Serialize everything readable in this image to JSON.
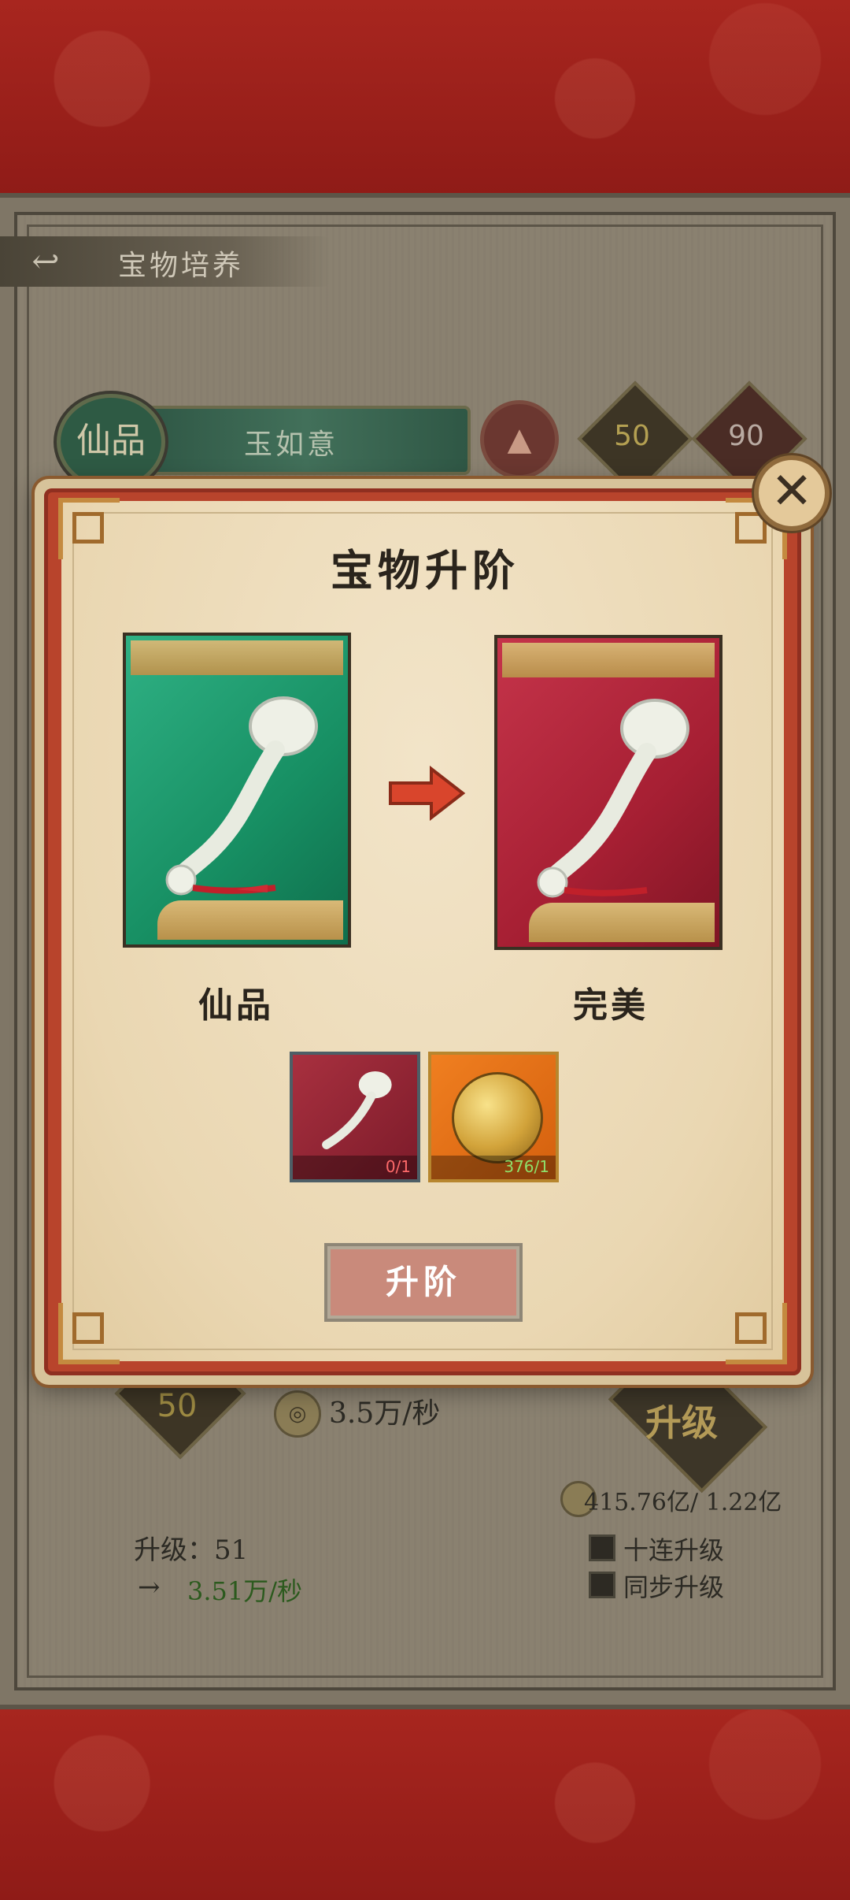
{
  "header": {
    "back_icon": "back-arrow-icon",
    "title": "宝物培养"
  },
  "treasure": {
    "grade_badge": "仙品",
    "name": "玉如意",
    "element_icon": "mountain-icon",
    "stat_a": "50",
    "stat_b": "90"
  },
  "background_stats": {
    "level": "50",
    "rate": "3.5万/秒",
    "upgrade_stamp": "升级",
    "gold": "415.76亿/ 1.22亿",
    "next_level": "升级：51",
    "next_arrow": "→",
    "next_rate": "3.51万/秒",
    "options": [
      "十连升级",
      "同步升级"
    ]
  },
  "modal": {
    "title": "宝物升阶",
    "close_icon": "close-icon",
    "current_grade": "仙品",
    "next_grade": "完美",
    "arrow_icon": "right-arrow-icon",
    "materials": [
      {
        "icon": "ruyi-fragment-icon",
        "count": "0/1"
      },
      {
        "icon": "gold-dragon-orb-icon",
        "count": "376/1"
      }
    ],
    "advance_button": "升阶"
  },
  "colors": {
    "background_red": "#9c2420",
    "modal_frame": "#b8442c",
    "card_current": "#178f63",
    "card_next": "#a61f33",
    "insufficient": "#ff6a6a",
    "sufficient": "#8fe06a"
  }
}
